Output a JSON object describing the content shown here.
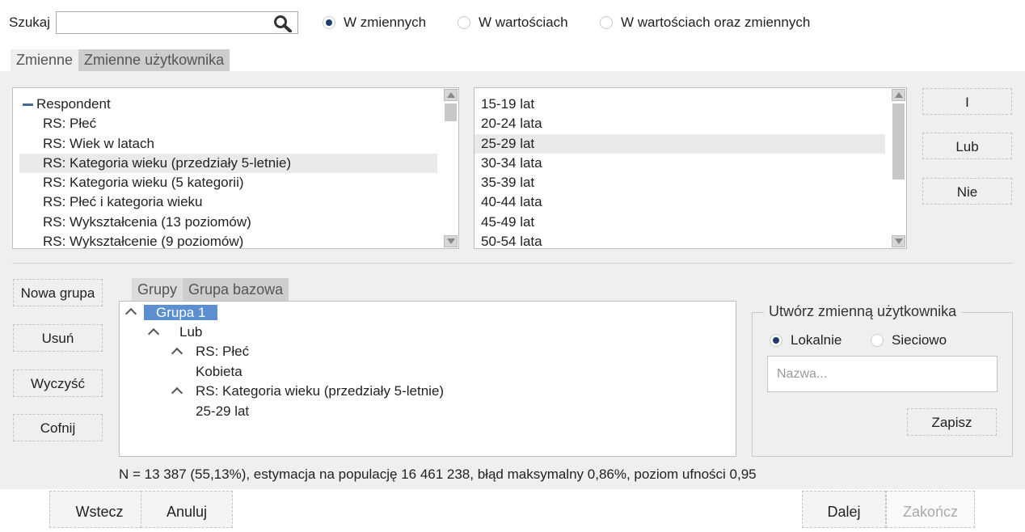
{
  "search": {
    "label": "Szukaj",
    "value": "",
    "placeholder": "",
    "icon": "search-icon"
  },
  "search_scope": {
    "options": [
      "W zmiennych",
      "W wartościach",
      "W wartościach oraz zmiennych"
    ],
    "selected": "W zmiennych"
  },
  "top_tabs": [
    "Zmienne",
    "Zmienne użytkownika"
  ],
  "variables": {
    "root": "Respondent",
    "items": [
      "RS: Płeć",
      "RS: Wiek w latach",
      "RS: Kategoria wieku (przedziały 5-letnie)",
      "RS: Kategoria wieku (5 kategorii)",
      "RS: Płeć i kategoria wieku",
      "RS: Wykształcenia (13 poziomów)",
      "RS: Wykształcenie (9 poziomów)"
    ],
    "selected": "RS: Kategoria wieku (przedziały 5-letnie)"
  },
  "values": {
    "items": [
      "15-19 lat",
      "20-24 lata",
      "25-29 lat",
      "30-34 lata",
      "35-39 lat",
      "40-44 lata",
      "45-49 lat",
      "50-54 lata"
    ],
    "selected": "25-29 lat"
  },
  "logic_buttons": {
    "and": "I",
    "or": "Lub",
    "not": "Nie"
  },
  "group_buttons": {
    "new": "Nowa grupa",
    "delete": "Usuń",
    "clear": "Wyczyść",
    "undo": "Cofnij"
  },
  "group_tabs": [
    "Grupy",
    "Grupa bazowa"
  ],
  "group_tree": {
    "group": "Grupa 1",
    "operator": "Lub",
    "conditions": [
      {
        "variable": "RS: Płeć",
        "value": "Kobieta"
      },
      {
        "variable": "RS: Kategoria wieku (przedziały 5-letnie)",
        "value": "25-29 lat"
      }
    ]
  },
  "create_variable": {
    "title": "Utwórz zmienną użytkownika",
    "scope_options": [
      "Lokalnie",
      "Sieciowo"
    ],
    "scope_selected": "Lokalnie",
    "name_value": "",
    "name_placeholder": "Nazwa...",
    "save": "Zapisz"
  },
  "status": "N = 13 387 (55,13%), estymacja na populację 16 461 238, błąd maksymalny 0,86%, poziom ufności 0,95",
  "nav": {
    "back": "Wstecz",
    "cancel": "Anuluj",
    "next": "Dalej",
    "finish": "Zakończ"
  },
  "colors": {
    "selection": "#5b8fd0",
    "radio_on": "#1f3e6e",
    "panel": "#efefef"
  }
}
